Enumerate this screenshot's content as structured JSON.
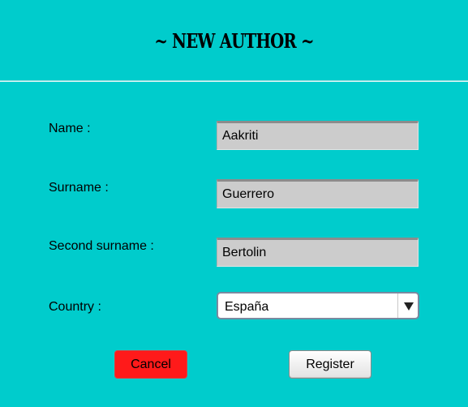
{
  "form": {
    "title": "~ NEW AUTHOR ~",
    "fields": {
      "name": {
        "label": "Name :",
        "value": "Aakriti"
      },
      "surname": {
        "label": "Surname :",
        "value": "Guerrero"
      },
      "second_surname": {
        "label": "Second surname :",
        "value": "Bertolin"
      },
      "country": {
        "label": "Country :",
        "value": "España"
      }
    },
    "buttons": {
      "cancel": "Cancel",
      "register": "Register"
    }
  },
  "colors": {
    "background": "#00cccc",
    "input_background": "#cccccc",
    "cancel_button": "#ff1a1a",
    "register_button": "#f0f0f0"
  },
  "icons": {
    "country_dropdown": "chevron-down-icon"
  }
}
